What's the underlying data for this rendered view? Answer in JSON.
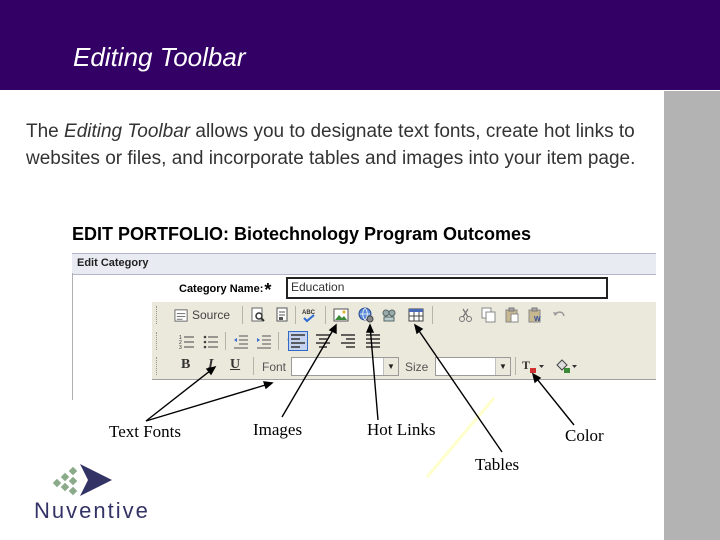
{
  "header": {
    "title": "Editing Toolbar"
  },
  "intro": {
    "prefix": "The ",
    "emphasis": "Editing Toolbar",
    "suffix": " allows you to designate text fonts, create hot links to websites or files, and incorporate tables and images into your item page."
  },
  "screenshot": {
    "title": "EDIT PORTFOLIO: Biotechnology Program Outcomes",
    "section": "Edit Category",
    "category_label": "Category Name:",
    "required_mark": "*",
    "category_value": "Education",
    "toolbar": {
      "source_label": "Source",
      "bold": "B",
      "italic": "I",
      "underline": "U",
      "font_label": "Font",
      "size_label": "Size",
      "dropdown_arrow": "▼"
    }
  },
  "callouts": {
    "text_fonts": "Text Fonts",
    "images": "Images",
    "hot_links": "Hot Links",
    "tables": "Tables",
    "color": "Color"
  },
  "logo": {
    "text": "Nuventive"
  },
  "colors": {
    "header_bg": "#330066",
    "sidebar": "#b3b3b3",
    "highlight_line": "#ffffcc"
  }
}
